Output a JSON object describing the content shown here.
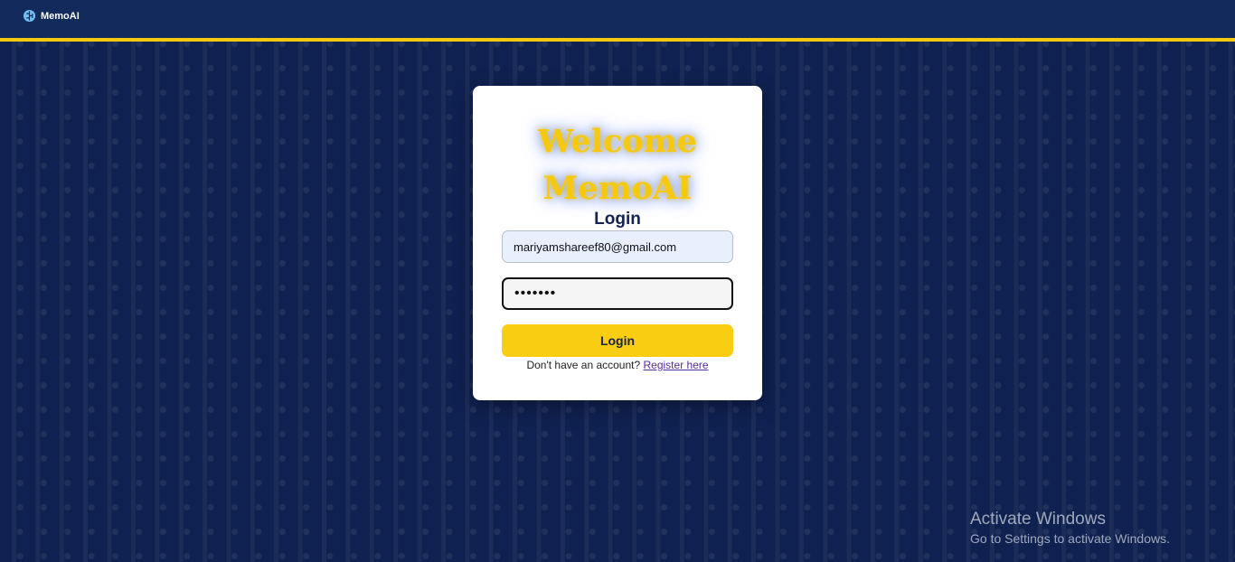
{
  "navbar": {
    "brand_name": "MemoAI",
    "brand_icon": "brain-icon"
  },
  "login_card": {
    "welcome_line1": "Welcome",
    "welcome_line2": "MemoAI",
    "title": "Login",
    "email_value": "mariyamshareef80@gmail.com",
    "password_value": "•••••••",
    "submit_label": "Login",
    "register_prompt": "Don't have an account?",
    "register_link": "Register here"
  },
  "watermark": {
    "title": "Activate Windows",
    "subtitle": "Go to Settings to activate Windows."
  },
  "colors": {
    "background": "#0f2150",
    "navbar": "#122a5c",
    "accent": "#f6c90e",
    "button": "#f9cd12"
  }
}
